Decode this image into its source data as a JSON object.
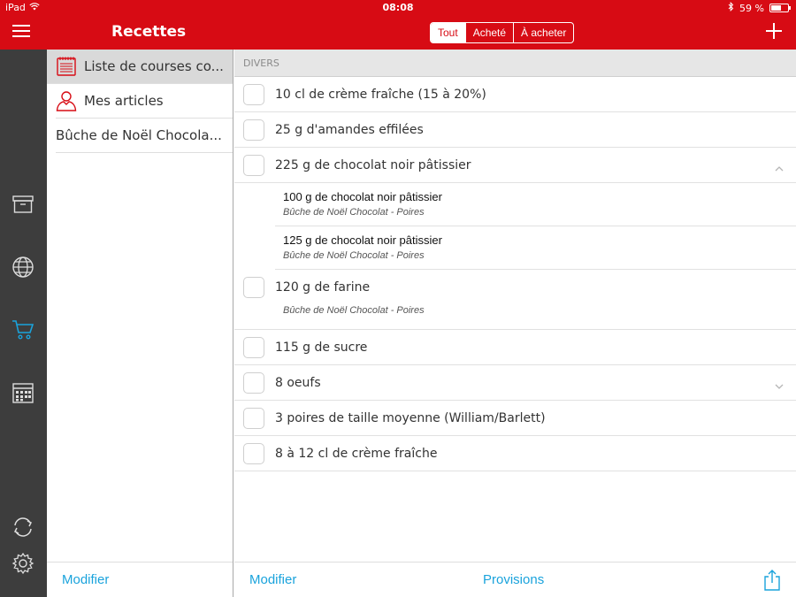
{
  "status": {
    "device": "iPad",
    "time": "08:08",
    "battery": "59 %",
    "battery_level": 0.59
  },
  "nav": {
    "title": "Recettes",
    "segments": [
      "Tout",
      "Acheté",
      "À acheter"
    ],
    "active_segment": 0
  },
  "sidebar": {
    "items": [
      {
        "label": "Liste de courses co...",
        "icon": "notepad-icon",
        "selected": true
      },
      {
        "label": "Mes articles",
        "icon": "person-icon",
        "selected": false
      },
      {
        "label": "Bûche de Noël Chocola...",
        "icon": "",
        "selected": false
      }
    ],
    "footer_label": "Modifier"
  },
  "rail_icons": [
    "archive-icon",
    "globe-icon",
    "cart-icon",
    "calendar-icon",
    "sync-icon",
    "settings-icon"
  ],
  "main": {
    "section": "DIVERS",
    "rows": [
      {
        "label": "10 cl de crème fraîche (15 à 20%)"
      },
      {
        "label": "25 g d'amandes effilées"
      },
      {
        "label": "225 g de chocolat noir pâtissier",
        "expanded": true,
        "subitems": [
          {
            "name": "100 g de chocolat noir pâtissier",
            "recipe": "Bûche de Noël Chocolat - Poires"
          },
          {
            "name": "125 g de chocolat noir pâtissier",
            "recipe": "Bûche de Noël Chocolat - Poires"
          }
        ]
      },
      {
        "label": "120 g de farine",
        "recipe": "Bûche de Noël Chocolat - Poires"
      },
      {
        "label": "115 g de sucre"
      },
      {
        "label": "8 oeufs",
        "collapsed_chevron": true
      },
      {
        "label": "3 poires de taille moyenne (William/Barlett)"
      },
      {
        "label": "8 à 12 cl de crème fraîche"
      }
    ],
    "footer": {
      "left": "Modifier",
      "center": "Provisions"
    }
  },
  "colors": {
    "brand_red": "#d70b14",
    "link_blue": "#1aa3dc",
    "rail_dark": "#3d3d3d",
    "cart_active": "#1aa3dc"
  }
}
